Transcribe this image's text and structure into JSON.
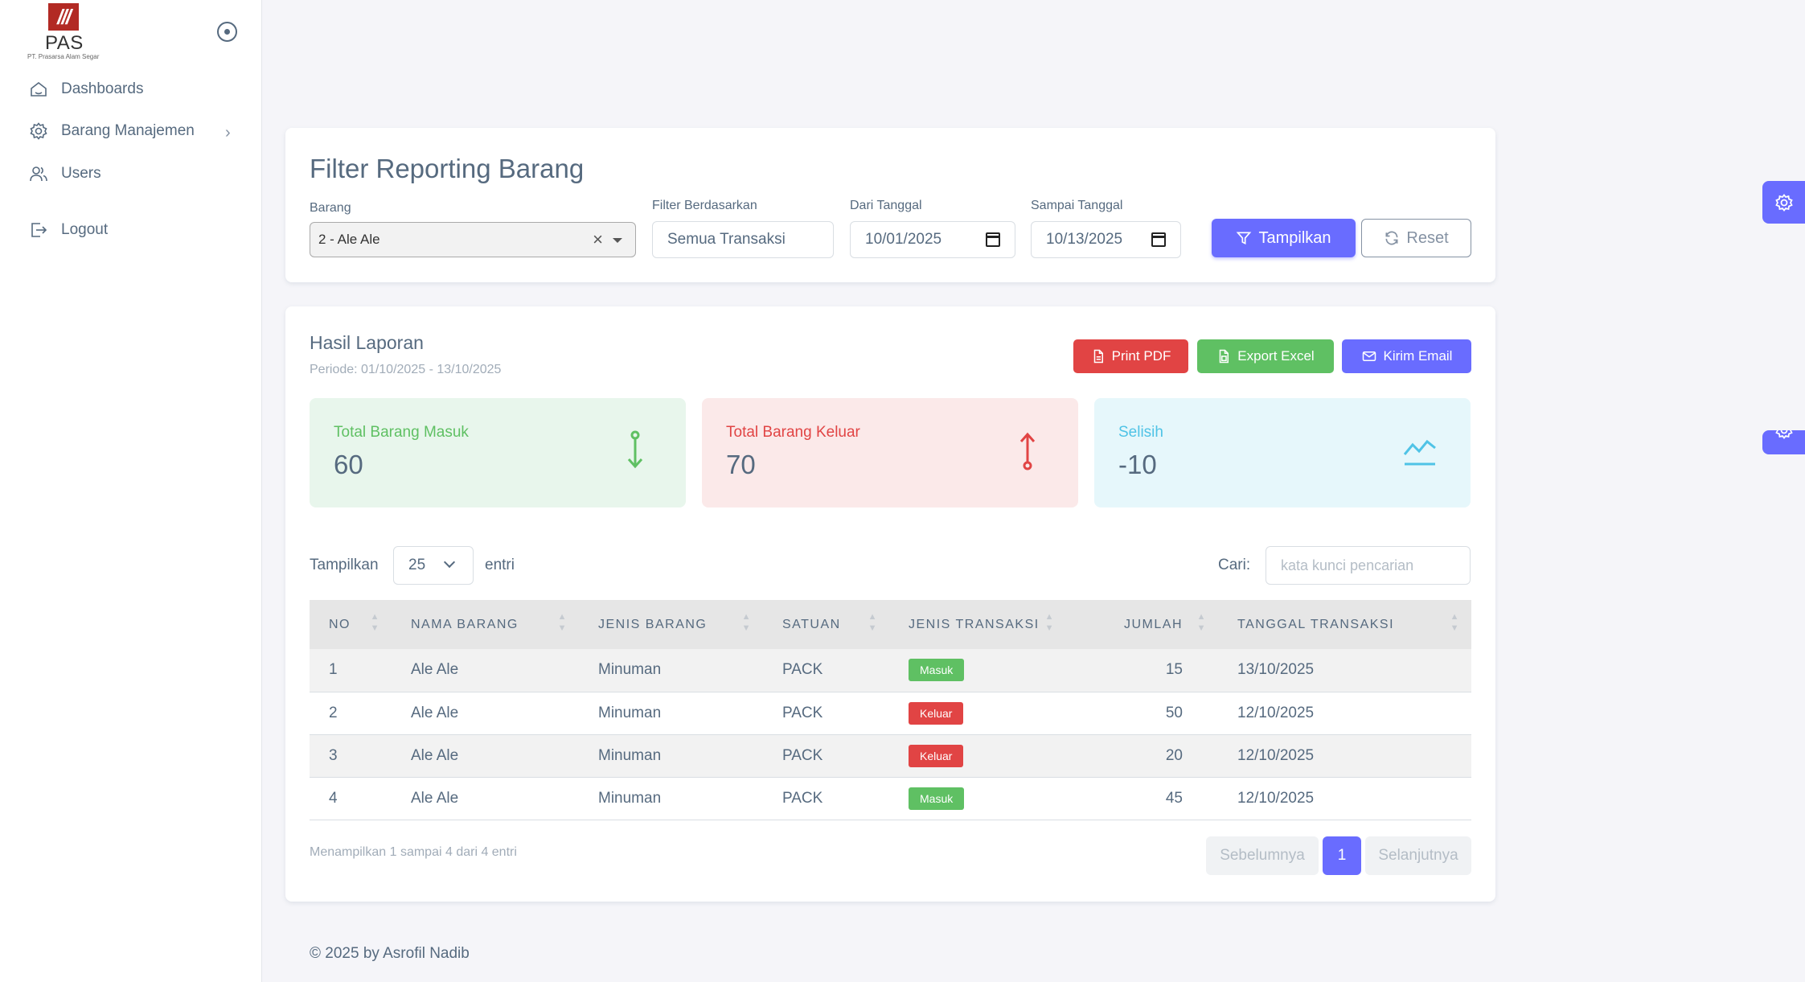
{
  "brand": {
    "logo_mark": "///",
    "name": "PAS",
    "subtitle": "PT. Prasarsa Alam Segar"
  },
  "sidebar": {
    "items": [
      {
        "label": "Dashboards",
        "icon": "home-icon"
      },
      {
        "label": "Barang Manajemen",
        "icon": "gear-icon"
      },
      {
        "label": "Users",
        "icon": "users-icon"
      },
      {
        "label": "Logout",
        "icon": "logout-icon"
      }
    ]
  },
  "filter": {
    "title": "Filter Reporting Barang",
    "barang_label": "Barang",
    "barang_value": "2 - Ale Ale",
    "filter_label": "Filter Berdasarkan",
    "filter_value": "Semua Transaksi",
    "dari_label": "Dari Tanggal",
    "dari_value": "10/01/2025",
    "sampai_label": "Sampai Tanggal",
    "sampai_value": "10/13/2025",
    "tampilkan_button": "Tampilkan",
    "reset_button": "Reset"
  },
  "report": {
    "title": "Hasil Laporan",
    "periode": "Periode: 01/10/2025 - 13/10/2025",
    "print_pdf": "Print PDF",
    "export_excel": "Export Excel",
    "kirim_email": "Kirim Email",
    "stats": {
      "masuk_label": "Total Barang Masuk",
      "masuk_value": "60",
      "keluar_label": "Total Barang Keluar",
      "keluar_value": "70",
      "selisih_label": "Selisih",
      "selisih_value": "-10"
    },
    "length_prefix": "Tampilkan",
    "length_value": "25",
    "length_suffix": "entri",
    "search_label": "Cari:",
    "search_placeholder": "kata kunci pencarian",
    "columns": [
      "NO",
      "NAMA BARANG",
      "JENIS BARANG",
      "SATUAN",
      "JENIS TRANSAKSI",
      "JUMLAH",
      "TANGGAL TRANSAKSI"
    ],
    "rows": [
      {
        "no": "1",
        "nama": "Ale Ale",
        "jenis": "Minuman",
        "satuan": "PACK",
        "transaksi": "Masuk",
        "jumlah": "15",
        "tanggal": "13/10/2025"
      },
      {
        "no": "2",
        "nama": "Ale Ale",
        "jenis": "Minuman",
        "satuan": "PACK",
        "transaksi": "Keluar",
        "jumlah": "50",
        "tanggal": "12/10/2025"
      },
      {
        "no": "3",
        "nama": "Ale Ale",
        "jenis": "Minuman",
        "satuan": "PACK",
        "transaksi": "Keluar",
        "jumlah": "20",
        "tanggal": "12/10/2025"
      },
      {
        "no": "4",
        "nama": "Ale Ale",
        "jenis": "Minuman",
        "satuan": "PACK",
        "transaksi": "Masuk",
        "jumlah": "45",
        "tanggal": "12/10/2025"
      }
    ],
    "info": "Menampilkan 1 sampai 4 dari 4 entri",
    "prev": "Sebelumnya",
    "page": "1",
    "next": "Selanjutnya"
  },
  "footer": "© 2025 by Asrofil Nadib",
  "colors": {
    "primary": "#696cff",
    "danger": "#e14444",
    "success": "#5fc063",
    "info": "#03c3ec"
  }
}
